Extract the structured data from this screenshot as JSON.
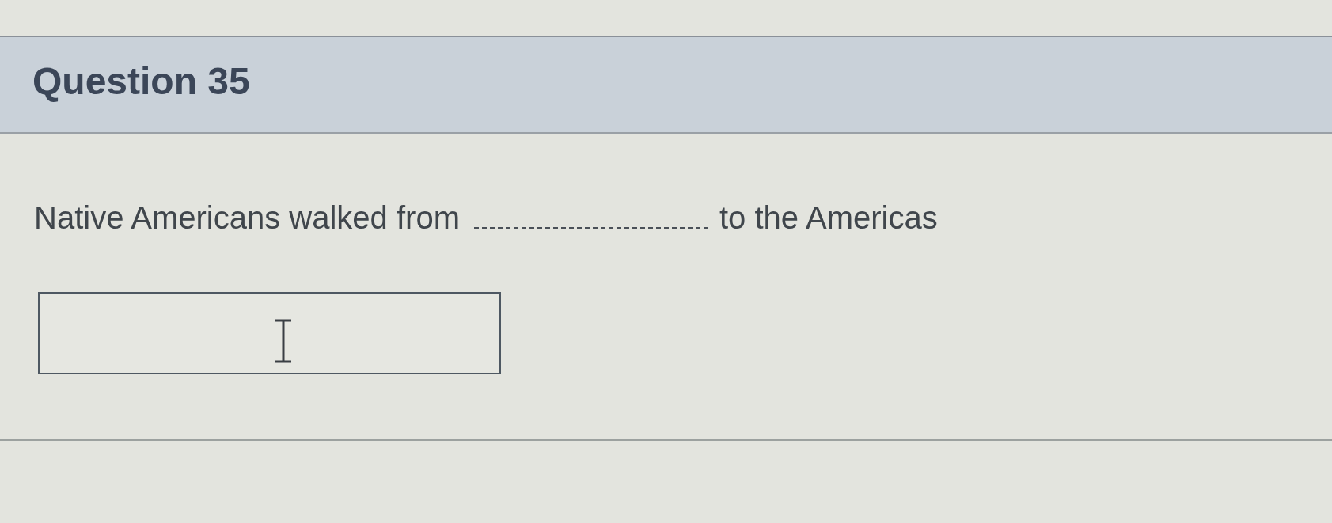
{
  "question": {
    "title": "Question 35",
    "prompt": [
      {
        "kind": "text",
        "text": "Native Americans walked from"
      },
      {
        "kind": "blank"
      },
      {
        "kind": "text",
        "text": "to the Americas"
      }
    ]
  }
}
